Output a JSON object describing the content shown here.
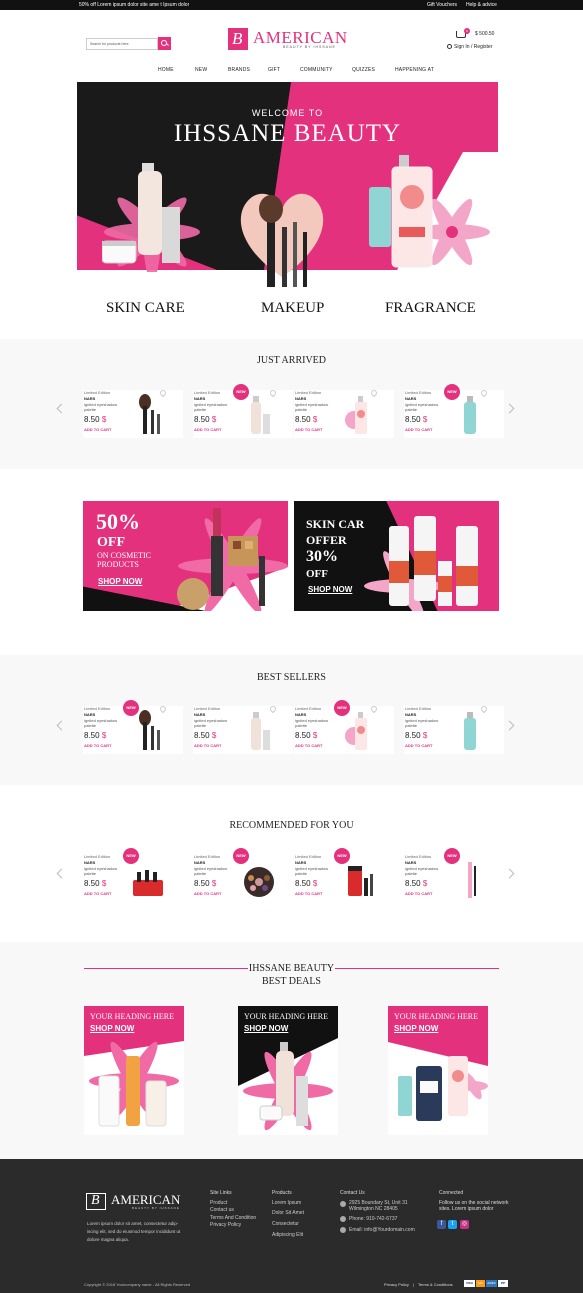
{
  "topbar": {
    "promo": "50% off Lorem ipsum dolor site ame t Ipsum dolor",
    "gift_vouchers": "Gift Vouchers",
    "help": "Help & advice"
  },
  "header": {
    "search_placeholder": "Search for products here",
    "logo_name": "AMERICAN",
    "logo_letter": "B",
    "logo_sub": "BEAUTY BY IHSSANE",
    "cart_count": "0",
    "cart_amount": "$ 500.50",
    "signin": "Sign In / Register"
  },
  "nav": [
    "HOME",
    "NEW",
    "BRANDS",
    "GIFT",
    "COMMUNITY",
    "QUIZZES",
    "HAPPENING AT"
  ],
  "hero": {
    "welcome": "WELCOME TO",
    "title": "IHSSANE BEAUTY",
    "categories": [
      "SKIN CARE",
      "MAKEUP",
      "FRAGRANCE"
    ]
  },
  "just_arrived": {
    "title": "JUST ARRIVED",
    "products": [
      {
        "edition": "Limited Edition",
        "brand": "NARS",
        "name": "ignited eyeshadow palette",
        "price": "8.50",
        "currency": "$",
        "cta": "ADD TO CART",
        "new": false
      },
      {
        "edition": "Limited Edition",
        "brand": "NARS",
        "name": "ignited eyeshadow palette",
        "price": "8.50",
        "currency": "$",
        "cta": "ADD TO CART",
        "new": true
      },
      {
        "edition": "Limited Edition",
        "brand": "NARS",
        "name": "ignited eyeshadow palette",
        "price": "8.50",
        "currency": "$",
        "cta": "ADD TO CART",
        "new": false
      },
      {
        "edition": "Limited Edition",
        "brand": "NARS",
        "name": "ignited eyeshadow palette",
        "price": "8.50",
        "currency": "$",
        "cta": "ADD TO CART",
        "new": true
      }
    ]
  },
  "offers": {
    "left": {
      "big": "50%",
      "off": "OFF",
      "sub1": "ON COSMETIC",
      "sub2": "PRODUCTS",
      "cta": "SHOP NOW"
    },
    "right": {
      "line1": "SKIN CAR",
      "line2": "OFFER",
      "big": "30%",
      "off": "OFF",
      "cta": "SHOP NOW"
    }
  },
  "best_sellers": {
    "title": "BEST SELLERS",
    "products": [
      {
        "edition": "Limited Edition",
        "brand": "NARS",
        "name": "ignited eyeshadow palette",
        "price": "8.50",
        "currency": "$",
        "cta": "ADD TO CART",
        "new": true
      },
      {
        "edition": "Limited Edition",
        "brand": "NARS",
        "name": "ignited eyeshadow palette",
        "price": "8.50",
        "currency": "$",
        "cta": "ADD TO CART",
        "new": false
      },
      {
        "edition": "Limited Edition",
        "brand": "NARS",
        "name": "ignited eyeshadow palette",
        "price": "8.50",
        "currency": "$",
        "cta": "ADD TO CART",
        "new": true
      },
      {
        "edition": "Limited Edition",
        "brand": "NARS",
        "name": "ignited eyeshadow palette",
        "price": "8.50",
        "currency": "$",
        "cta": "ADD TO CART",
        "new": false
      }
    ]
  },
  "recommended": {
    "title": "RECOMMENDED FOR YOU",
    "products": [
      {
        "edition": "Limited Edition",
        "brand": "NARS",
        "name": "ignited eyeshadow palette",
        "price": "8.50",
        "currency": "$",
        "cta": "ADD TO CART",
        "new": true
      },
      {
        "edition": "Limited Edition",
        "brand": "NARS",
        "name": "ignited eyeshadow palette",
        "price": "8.50",
        "currency": "$",
        "cta": "ADD TO CART",
        "new": true
      },
      {
        "edition": "Limited Edition",
        "brand": "NARS",
        "name": "ignited eyeshadow palette",
        "price": "8.50",
        "currency": "$",
        "cta": "ADD TO CART",
        "new": true
      },
      {
        "edition": "Limited Edition",
        "brand": "NARS",
        "name": "ignited eyeshadow palette",
        "price": "8.50",
        "currency": "$",
        "cta": "ADD TO CART",
        "new": true
      }
    ]
  },
  "best_deals": {
    "title1": "IHSSANE BEAUTY",
    "title2": "BEST DEALS",
    "cards": [
      {
        "heading": "YOUR HEADING HERE",
        "cta": "SHOP NOW"
      },
      {
        "heading": "YOUR HEADING HERE",
        "cta": "SHOP NOW"
      },
      {
        "heading": "YOUR HEADING HERE",
        "cta": "SHOP NOW"
      }
    ]
  },
  "footer": {
    "logo_name": "AMERICAN",
    "logo_letter": "B",
    "logo_sub": "BEAUTY BY IHSSANE",
    "about": "Lorem ipsum dolor sit amet, consectetur adip-iscing elit, sed do eiusmod tempor incididunt ut dolore magna aliqua.",
    "site_links_title": "Site Links",
    "site_links": [
      "Product",
      "Contact us",
      "Terms And Condition",
      "Privacy Policy"
    ],
    "products_title": "Products",
    "products": [
      "Lorem Ipsum",
      "Dolor Sit Amet",
      "Consectetur",
      "Adipiscing Elit"
    ],
    "contact_title": "Contact Us",
    "address": "2925 Boundary St, Unit 31 Wilmington NC 28405",
    "phone": "Phone: 910-742-6737",
    "email": "Email: info@Yourdomain.com",
    "connected_title": "Connected",
    "connected_text": "Follow us on the social network sites. Lorem ipsum dolor",
    "copyright": "Copyright © 2018 Yourcompany name - All Rights Reserved",
    "privacy": "Privacy Policy",
    "separator": "|",
    "terms": "Terms & Conditions",
    "payments": [
      "VISA",
      "MC",
      "AMEX",
      "PP"
    ]
  },
  "colors": {
    "accent": "#e4317d",
    "dark": "#111111",
    "footer": "#2b2b2b"
  }
}
